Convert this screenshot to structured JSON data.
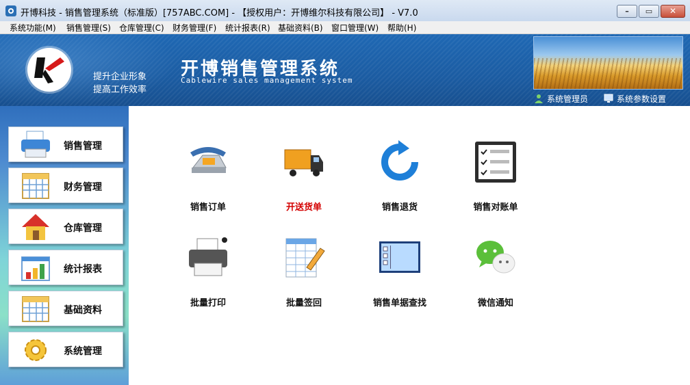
{
  "window": {
    "title": "开博科技 - 销售管理系统（标准版）[757ABC.COM] - 【授权用户：开博维尔科技有限公司】 - V7.0"
  },
  "menu": [
    "系统功能(M)",
    "销售管理(S)",
    "仓库管理(C)",
    "财务管理(F)",
    "统计报表(R)",
    "基础资料(B)",
    "窗口管理(W)",
    "帮助(H)"
  ],
  "banner": {
    "slogan_line1": "提升企业形象",
    "slogan_line2": "提高工作效率",
    "title": "开博销售管理系统",
    "subtitle": "Cablewire sales management system",
    "user_link": "系统管理员",
    "settings_link": "系统参数设置"
  },
  "sidebar": {
    "items": [
      {
        "label": "销售管理",
        "icon": "printer-icon"
      },
      {
        "label": "财务管理",
        "icon": "calendar-grid-icon"
      },
      {
        "label": "仓库管理",
        "icon": "house-icon"
      },
      {
        "label": "统计报表",
        "icon": "bar-chart-icon"
      },
      {
        "label": "基础资料",
        "icon": "calendar-grid-icon"
      },
      {
        "label": "系统管理",
        "icon": "gear-icon"
      }
    ]
  },
  "tiles": [
    {
      "label": "销售订单",
      "icon": "telephone-icon"
    },
    {
      "label": "开送货单",
      "icon": "truck-icon",
      "highlight": "#d40000"
    },
    {
      "label": "销售退货",
      "icon": "refresh-arrow-icon"
    },
    {
      "label": "销售对账单",
      "icon": "checklist-icon"
    },
    {
      "label": "批量打印",
      "icon": "printer-icon"
    },
    {
      "label": "批量签回",
      "icon": "spreadsheet-pencil-icon"
    },
    {
      "label": "销售单据查找",
      "icon": "window-list-icon"
    },
    {
      "label": "微信通知",
      "icon": "wechat-icon"
    }
  ],
  "colors": {
    "banner": "#1f68b4",
    "highlight": "#d40000"
  }
}
